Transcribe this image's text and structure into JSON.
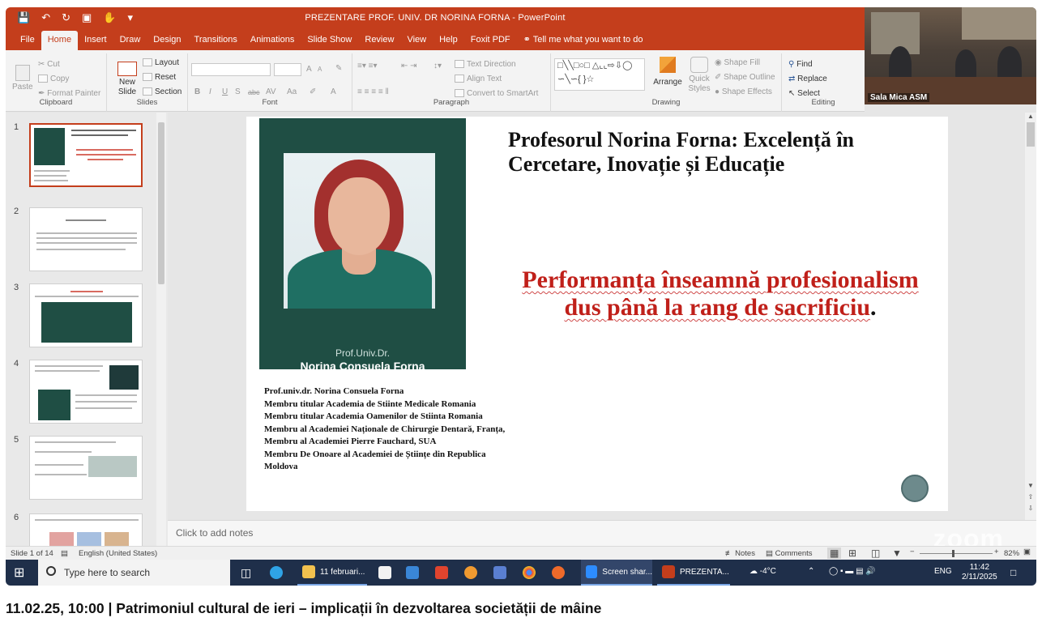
{
  "window": {
    "title": "PREZENTARE PROF. UNIV. DR NORINA FORNA  -  PowerPoint",
    "tell_me": "Tell me what you want to do"
  },
  "tabs": [
    "File",
    "Home",
    "Insert",
    "Draw",
    "Design",
    "Transitions",
    "Animations",
    "Slide Show",
    "Review",
    "View",
    "Help",
    "Foxit PDF"
  ],
  "ribbon": {
    "clipboard": {
      "paste": "Paste",
      "cut": "Cut",
      "copy": "Copy",
      "format_painter": "Format Painter",
      "label": "Clipboard"
    },
    "slides": {
      "new_slide": "New Slide",
      "layout": "Layout",
      "reset": "Reset",
      "section": "Section",
      "label": "Slides"
    },
    "font": {
      "label": "Font",
      "bold": "B",
      "italic": "I",
      "underline": "U",
      "strike": "S",
      "abc": "abc",
      "av": "AV",
      "aa": "Aa",
      "a_color": "A",
      "grow": "A",
      "shrink": "A"
    },
    "paragraph": {
      "text_direction": "Text Direction",
      "align_text": "Align Text",
      "convert_smartart": "Convert to SmartArt",
      "label": "Paragraph"
    },
    "drawing": {
      "arrange": "Arrange",
      "quick_styles": "Quick Styles",
      "shape_fill": "Shape Fill",
      "shape_outline": "Shape Outline",
      "shape_effects": "Shape Effects",
      "label": "Drawing"
    },
    "editing": {
      "find": "Find",
      "replace": "Replace",
      "select": "Select",
      "label": "Editing"
    }
  },
  "video": {
    "label": "Sala Mica ASM"
  },
  "thumbnails": [
    "1",
    "2",
    "3",
    "4",
    "5",
    "6"
  ],
  "slide": {
    "title": "Profesorul Norina Forna: Excelență în Cercetare, Inovație și Educație",
    "photo_caption_1": "Prof.Univ.Dr.",
    "photo_caption_2": "Norina Consuela Forna",
    "quote": "Performanța înseamnă profesionalism dus până la rang de sacrificiu",
    "quote_end": ".",
    "bio": [
      "Prof.univ.dr. Norina Consuela Forna",
      "Membru titular Academia de Stiinte Medicale Romania",
      "Membru titular Academia Oamenilor de Stiinta Romania",
      "Membru al Academiei Naționale de Chirurgie Dentară, Franța,",
      "Membru al Academiei Pierre Fauchard, SUA",
      "Membru De Onoare al Academiei de Științe din Republica Moldova"
    ]
  },
  "notes": {
    "placeholder": "Click to add notes",
    "watermark": "zoom"
  },
  "status": {
    "slide_count": "Slide 1 of 14",
    "language": "English (United States)",
    "notes": "Notes",
    "comments": "Comments",
    "zoom": "82%"
  },
  "taskbar": {
    "search_placeholder": "Type here to search",
    "items": [
      {
        "label": "11 februari...",
        "color": "#f2c14e"
      },
      {
        "label": "Screen shar...",
        "color": "#2d8cff"
      },
      {
        "label": "PREZENTA...",
        "color": "#c43e1c"
      }
    ],
    "weather": "-4°C",
    "lang": "ENG",
    "time": "11:42",
    "date": "2/11/2025"
  },
  "caption": "11.02.25, 10:00 | Patrimoniul cultural de ieri – implicații în dezvoltarea societății de mâine"
}
